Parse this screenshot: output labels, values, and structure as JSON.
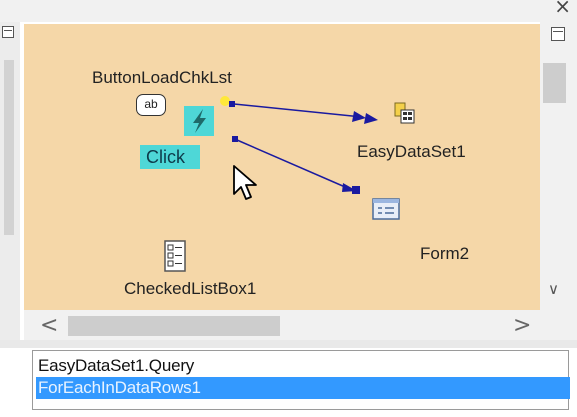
{
  "window": {
    "close_glyph": "×"
  },
  "canvas": {
    "button_component_label": "ButtonLoadChkLst",
    "event_label": "Click",
    "ab_icon_text": "ab",
    "easydataset_label": "EasyDataSet1",
    "form2_label": "Form2",
    "checkedlistbox_label": "CheckedListBox1"
  },
  "scrollbars": {
    "left_arrow": "<",
    "right_arrow": ">",
    "down_arrow": "∨"
  },
  "action_list": {
    "items": [
      {
        "label": "EasyDataSet1.Query",
        "selected": false
      },
      {
        "label": "ForEachInDataRows1",
        "selected": true
      }
    ]
  },
  "colors": {
    "canvas_background": "#f5d7a8",
    "event_highlight": "#4ed7d7",
    "connector": "#1a1aa0",
    "selection": "#3399ff"
  }
}
